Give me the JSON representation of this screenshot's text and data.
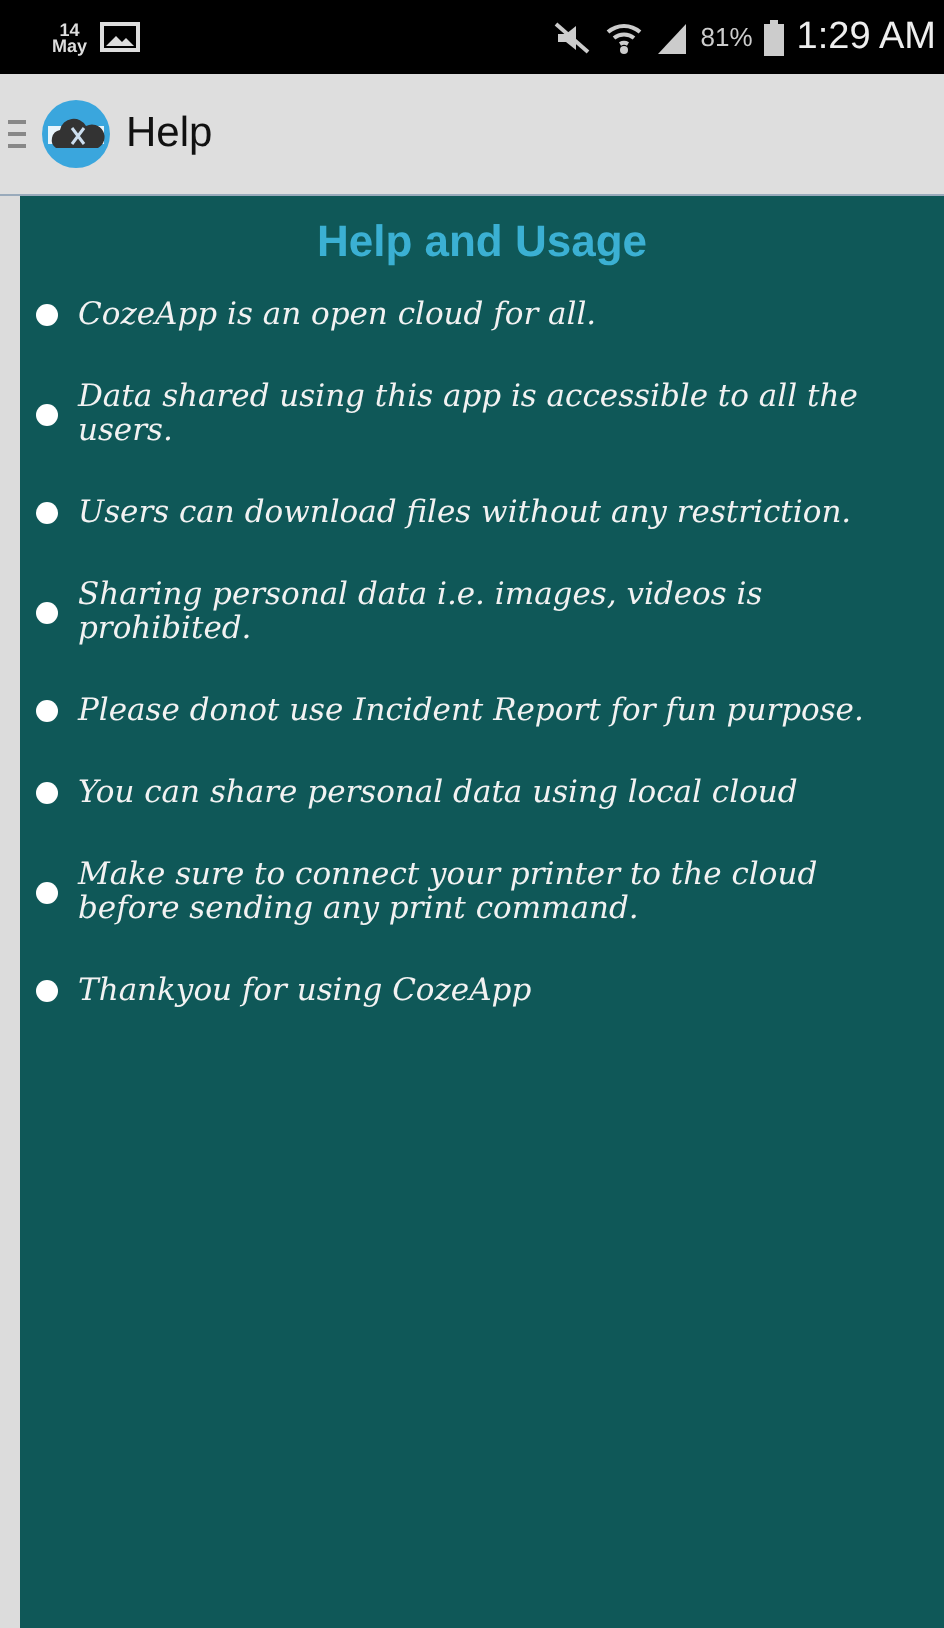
{
  "status_bar": {
    "date_day": "14",
    "date_month": "May",
    "battery": "81%",
    "time": "1:29 AM"
  },
  "app_bar": {
    "title": "Help"
  },
  "content": {
    "heading": "Help and Usage",
    "items": [
      "CozeApp is an open cloud for all.",
      "Data shared using this app is accessible to all the users.",
      "Users can download files without any restriction.",
      "Sharing personal data i.e. images, videos is prohibited.",
      "Please donot use Incident Report for fun purpose.",
      "You can share personal data using local cloud",
      "Make sure to connect your printer to the cloud before sending any print command.",
      "Thankyou for using CozeApp"
    ]
  }
}
